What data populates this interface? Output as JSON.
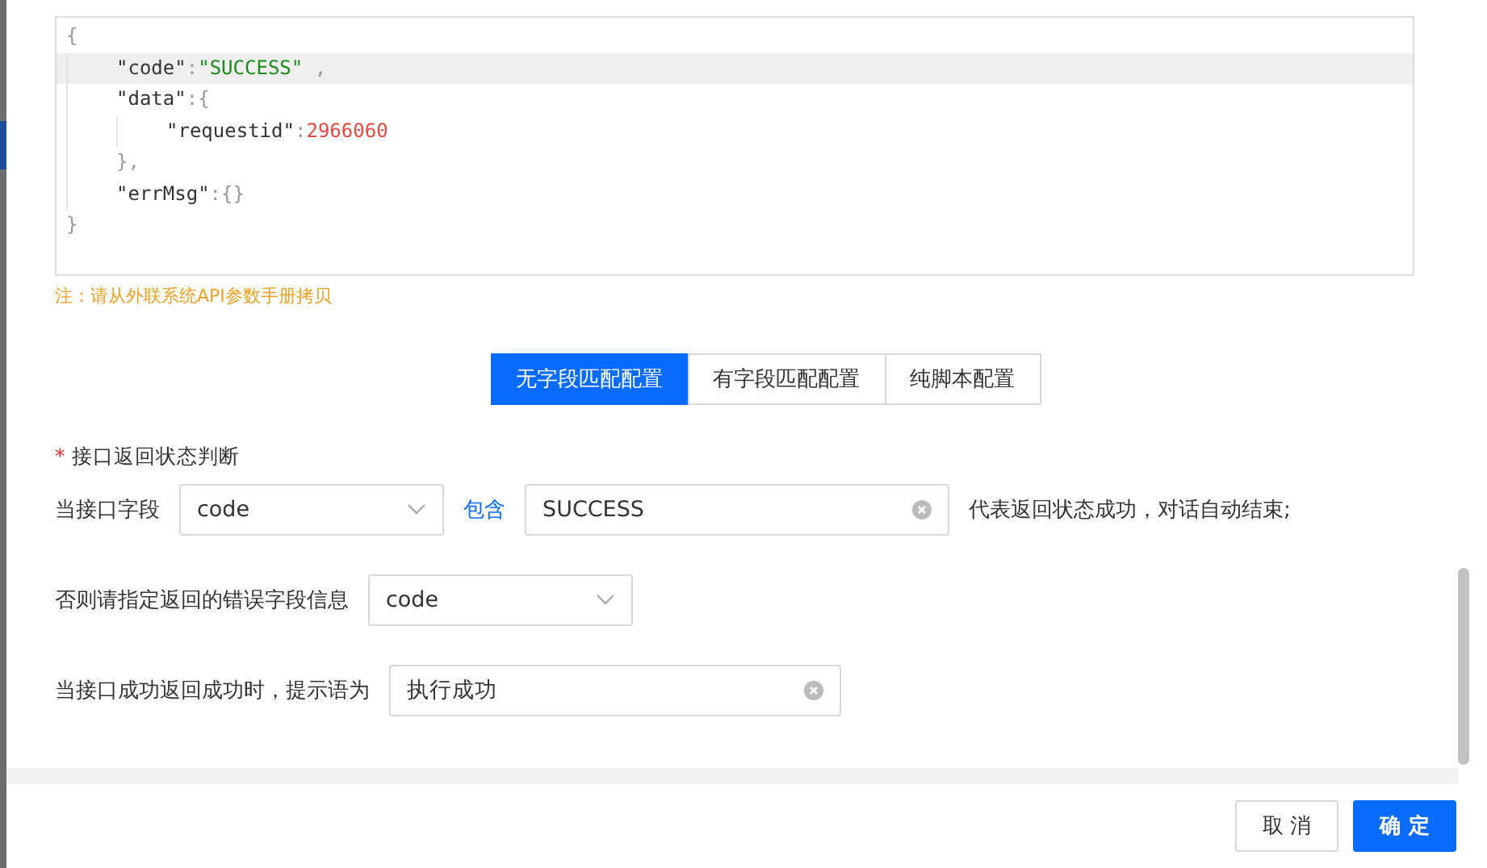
{
  "code_editor": {
    "lines": [
      {
        "highlighted": false,
        "tokens": [
          {
            "kind": "punct",
            "text": "{"
          }
        ],
        "children": [
          {
            "highlighted": true,
            "tokens": [
              {
                "kind": "key",
                "text": "\"code\""
              },
              {
                "kind": "punct",
                "text": ":"
              },
              {
                "kind": "string",
                "text": "\"SUCCESS\""
              },
              {
                "kind": "punct",
                "text": " ,"
              }
            ]
          },
          {
            "highlighted": false,
            "tokens": [
              {
                "kind": "key",
                "text": "\"data\""
              },
              {
                "kind": "punct",
                "text": ":{"
              }
            ],
            "children": [
              {
                "highlighted": false,
                "tokens": [
                  {
                    "kind": "key",
                    "text": "\"requestid\""
                  },
                  {
                    "kind": "punct",
                    "text": ":"
                  },
                  {
                    "kind": "number",
                    "text": "2966060"
                  }
                ]
              }
            ]
          },
          {
            "highlighted": false,
            "tokens": [
              {
                "kind": "punct",
                "text": "},"
              }
            ]
          },
          {
            "highlighted": false,
            "tokens": [
              {
                "kind": "key",
                "text": "\"errMsg\""
              },
              {
                "kind": "punct",
                "text": ":{}"
              }
            ]
          }
        ]
      },
      {
        "highlighted": false,
        "tokens": [
          {
            "kind": "punct",
            "text": "}"
          }
        ]
      }
    ]
  },
  "note": "注：请从外联系统API参数手册拷贝",
  "tabs": [
    {
      "label": "无字段匹配配置",
      "selected": true
    },
    {
      "label": "有字段匹配配置",
      "selected": false
    },
    {
      "label": "纯脚本配置",
      "selected": false
    }
  ],
  "status_section": {
    "title": "接口返回状态判断",
    "required_mark": "*",
    "prefix": "当接口字段",
    "field_select": {
      "value": "code"
    },
    "operator": "包含",
    "value_input": {
      "value": "SUCCESS"
    },
    "suffix": "代表返回状态成功，对话自动结束;"
  },
  "error_row": {
    "label": "否则请指定返回的错误字段信息",
    "select": {
      "value": "code"
    }
  },
  "success_row": {
    "label": "当接口成功返回成功时，提示语为",
    "input": {
      "value": "执行成功"
    }
  },
  "footer": {
    "buttons": [
      {
        "label": "取 消",
        "kind": "default"
      },
      {
        "label": "确 定",
        "kind": "primary"
      }
    ]
  }
}
